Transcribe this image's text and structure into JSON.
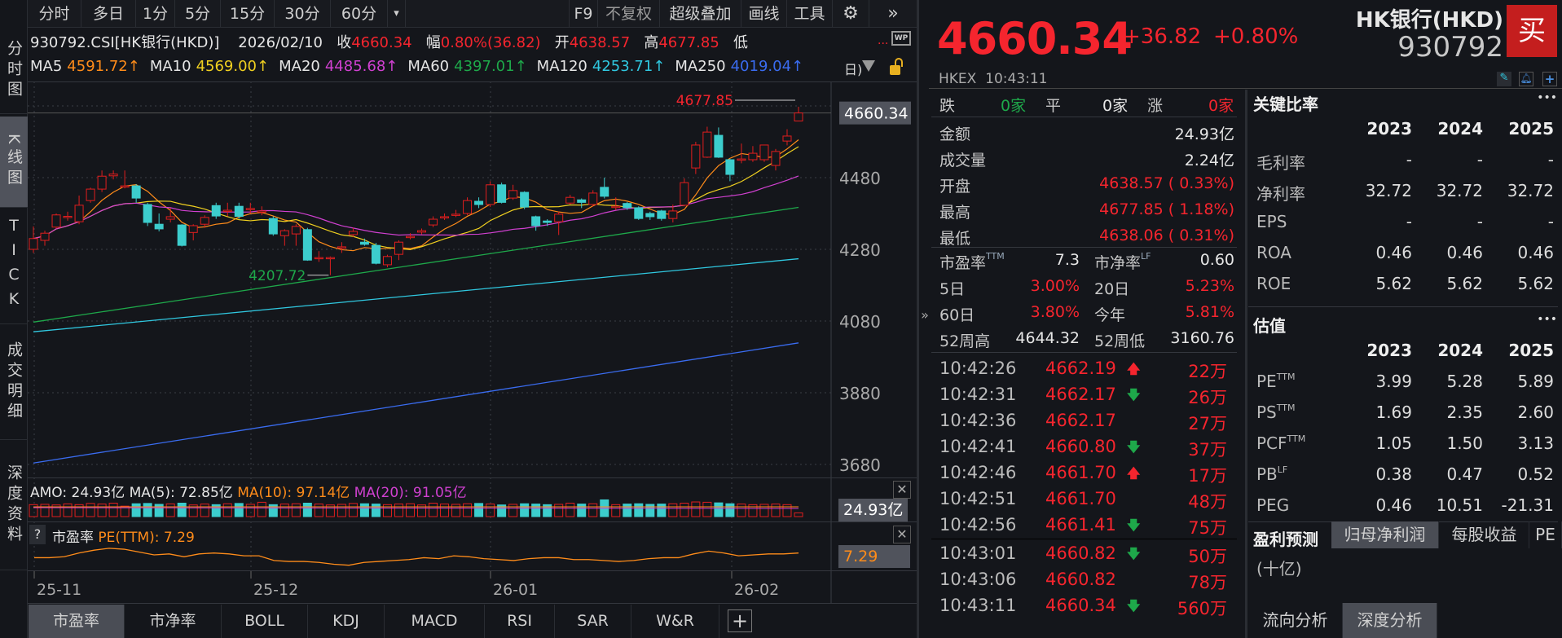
{
  "sidebar": {
    "items": [
      {
        "label": "分时图"
      },
      {
        "label": "K线图"
      },
      {
        "label": "TICK"
      },
      {
        "label": "成交明细"
      },
      {
        "label": "深度资料"
      }
    ]
  },
  "toolbar": {
    "periods": [
      "分时",
      "多日",
      "1分",
      "5分",
      "15分",
      "30分",
      "60分"
    ],
    "more": "▾",
    "f9": "F9",
    "adjust": "不复权",
    "overlay": "超级叠加",
    "draw": "画线",
    "tools": "工具",
    "gear": "⚙",
    "expand": "»"
  },
  "info": {
    "code": "930792.CSI[HK银行(HKD)]",
    "date": "2026/02/10",
    "close_label": "收",
    "close": "4660.34",
    "amp_label": "幅",
    "amp": "0.80%(36.82)",
    "open_label": "开",
    "open": "4638.57",
    "high_label": "高",
    "high": "4677.85",
    "low_label": "低",
    "more": "...",
    "wp": "WP"
  },
  "ma": [
    {
      "name": "MA5",
      "value": "4591.72↑",
      "color": "#ff8c1a"
    },
    {
      "name": "MA10",
      "value": "4569.00↑",
      "color": "#f0d020"
    },
    {
      "name": "MA20",
      "value": "4485.68↑",
      "color": "#d040d0"
    },
    {
      "name": "MA60",
      "value": "4397.01↑",
      "color": "#1ea84a"
    },
    {
      "name": "MA120",
      "value": "4253.71↑",
      "color": "#30c8e0"
    },
    {
      "name": "MA250",
      "value": "4019.04↑",
      "color": "#3a6cf0"
    }
  ],
  "ma_extra": "日)",
  "chart_data": {
    "type": "candlestick",
    "yticks": [
      4680,
      4480,
      4280,
      4080,
      3880,
      3680
    ],
    "ytick_labels": [
      "4680",
      "4480",
      "4280",
      "4080",
      "3880",
      "3680"
    ],
    "ylim": [
      3660,
      4700
    ],
    "xlabels": [
      {
        "label": "25-11",
        "index": 0
      },
      {
        "label": "25-12",
        "index": 19
      },
      {
        "label": "26-01",
        "index": 40
      },
      {
        "label": "26-02",
        "index": 61
      }
    ],
    "ohlc": [
      [
        4280,
        4344,
        4270,
        4310
      ],
      [
        4305,
        4332,
        4290,
        4325
      ],
      [
        4342,
        4380,
        4338,
        4376
      ],
      [
        4372,
        4385,
        4360,
        4372
      ],
      [
        4357,
        4430,
        4350,
        4403
      ],
      [
        4416,
        4452,
        4410,
        4448
      ],
      [
        4448,
        4500,
        4440,
        4484
      ],
      [
        4485,
        4500,
        4475,
        4490
      ],
      [
        4457,
        4500,
        4450,
        4457
      ],
      [
        4457,
        4462,
        4410,
        4423
      ],
      [
        4405,
        4410,
        4345,
        4355
      ],
      [
        4350,
        4380,
        4330,
        4337
      ],
      [
        4364,
        4395,
        4355,
        4371
      ],
      [
        4348,
        4350,
        4288,
        4291
      ],
      [
        4327,
        4350,
        4305,
        4346
      ],
      [
        4350,
        4375,
        4340,
        4369
      ],
      [
        4402,
        4410,
        4365,
        4373
      ],
      [
        4389,
        4410,
        4372,
        4389
      ],
      [
        4400,
        4410,
        4365,
        4372
      ],
      [
        4394,
        4410,
        4380,
        4394
      ],
      [
        4387,
        4400,
        4375,
        4387
      ],
      [
        4366,
        4372,
        4318,
        4323
      ],
      [
        4318,
        4336,
        4290,
        4332
      ],
      [
        4323,
        4350,
        4290,
        4344
      ],
      [
        4335,
        4340,
        4248,
        4250
      ],
      [
        4257,
        4275,
        4245,
        4257
      ],
      [
        4257,
        4260,
        4208,
        4257
      ],
      [
        4287,
        4300,
        4270,
        4287
      ],
      [
        4321,
        4340,
        4315,
        4330
      ],
      [
        4300,
        4310,
        4290,
        4294
      ],
      [
        4291,
        4298,
        4238,
        4241
      ],
      [
        4237,
        4265,
        4230,
        4260
      ],
      [
        4266,
        4305,
        4250,
        4300
      ],
      [
        4316,
        4325,
        4308,
        4316
      ],
      [
        4328,
        4338,
        4322,
        4332
      ],
      [
        4348,
        4372,
        4342,
        4364
      ],
      [
        4371,
        4380,
        4362,
        4371
      ],
      [
        4378,
        4390,
        4370,
        4378
      ],
      [
        4380,
        4425,
        4375,
        4416
      ],
      [
        4414,
        4425,
        4395,
        4405
      ],
      [
        4405,
        4470,
        4398,
        4460
      ],
      [
        4460,
        4466,
        4408,
        4411
      ],
      [
        4423,
        4460,
        4418,
        4444
      ],
      [
        4439,
        4442,
        4392,
        4398
      ],
      [
        4371,
        4374,
        4332,
        4346
      ],
      [
        4359,
        4364,
        4345,
        4355
      ],
      [
        4357,
        4385,
        4320,
        4378
      ],
      [
        4409,
        4432,
        4405,
        4425
      ],
      [
        4418,
        4422,
        4395,
        4411
      ],
      [
        4405,
        4445,
        4400,
        4437
      ],
      [
        4453,
        4480,
        4422,
        4428
      ],
      [
        4400,
        4425,
        4390,
        4400
      ],
      [
        4408,
        4412,
        4390,
        4396
      ],
      [
        4396,
        4400,
        4362,
        4366
      ],
      [
        4380,
        4385,
        4362,
        4371
      ],
      [
        4387,
        4390,
        4360,
        4366
      ],
      [
        4366,
        4405,
        4355,
        4387
      ],
      [
        4403,
        4478,
        4400,
        4466
      ],
      [
        4507,
        4580,
        4490,
        4571
      ],
      [
        4537,
        4622,
        4535,
        4607
      ],
      [
        4598,
        4620,
        4535,
        4537
      ],
      [
        4530,
        4532,
        4470,
        4489
      ],
      [
        4532,
        4575,
        4520,
        4532
      ],
      [
        4530,
        4568,
        4524,
        4548
      ],
      [
        4530,
        4571,
        4524,
        4571
      ],
      [
        4514,
        4560,
        4500,
        4553
      ],
      [
        4582,
        4615,
        4570,
        4596
      ],
      [
        4638,
        4677.85,
        4638,
        4660.34
      ]
    ],
    "ma_long": [
      {
        "name": "MA60",
        "start": 4077,
        "end": 4397.01,
        "color": "#1ea84a"
      },
      {
        "name": "MA120",
        "start": 4050,
        "end": 4253.71,
        "color": "#30c8e0"
      },
      {
        "name": "MA250",
        "start": 3684,
        "end": 4019.04,
        "color": "#3a6cf0"
      }
    ],
    "high_label": "4677.85",
    "low_label": "4207.72",
    "last_price": "4660.34",
    "amo": {
      "title": "AMO: 24.93亿",
      "ma5": "MA(5): 72.85亿",
      "ma10": "MA(10): 97.14亿",
      "ma20": "MA(20): 91.05亿",
      "last": "24.93亿",
      "values": [
        80,
        82,
        78,
        85,
        80,
        88,
        84,
        90,
        70,
        86,
        88,
        82,
        85,
        90,
        78,
        84,
        80,
        86,
        88,
        82,
        96,
        80,
        84,
        86,
        90,
        84,
        78,
        82,
        88,
        86,
        84,
        80,
        84,
        86,
        78,
        90,
        84,
        82,
        86,
        88,
        84,
        78,
        82,
        86,
        84,
        80,
        82,
        90,
        84,
        86,
        112,
        80,
        84,
        86,
        82,
        84,
        86,
        90,
        98,
        96,
        92,
        86,
        84,
        80,
        82,
        84,
        80,
        25
      ]
    },
    "pe": {
      "help": "?",
      "title": "市盈率",
      "name": "PE(TTM): 7.29",
      "last": "7.29",
      "values": [
        7.2,
        7.2,
        7.22,
        7.3,
        7.36,
        7.4,
        7.38,
        7.32,
        7.26,
        7.28,
        7.22,
        7.28,
        7.3,
        7.28,
        7.24,
        7.24,
        7.14,
        7.12,
        7.12,
        7.1,
        7.06,
        7.04,
        7.1,
        7.12,
        7.14,
        7.16,
        7.2,
        7.18,
        7.24,
        7.22,
        7.18,
        7.16,
        7.14,
        7.18,
        7.2,
        7.2,
        7.16,
        7.16,
        7.14,
        7.12,
        7.14,
        7.18,
        7.2,
        7.2,
        7.28,
        7.34,
        7.3,
        7.24,
        7.26,
        7.28,
        7.28,
        7.3
      ]
    }
  },
  "bottom_tabs": [
    "市盈率",
    "市净率",
    "BOLL",
    "KDJ",
    "MACD",
    "RSI",
    "SAR",
    "W&R",
    "+"
  ],
  "quote": {
    "price": "4660.34",
    "change": "+36.82",
    "pct": "+0.80%",
    "name": "HK银行(HKD)",
    "code": "930792",
    "buy": "买",
    "exchange": "HKEX",
    "time": "10:43:11"
  },
  "breadth": {
    "down_label": "跌",
    "down": "0家",
    "flat_label": "平",
    "flat": "0家",
    "up_label": "涨",
    "up": "0家"
  },
  "stats": [
    {
      "label": "金额",
      "value": "24.93亿",
      "color": "wht"
    },
    {
      "label": "成交量",
      "value": "2.24亿",
      "color": "wht"
    },
    {
      "label": "开盘",
      "value": "4638.57 ( 0.33%)",
      "color": "red"
    },
    {
      "label": "最高",
      "value": "4677.85 ( 1.18%)",
      "color": "red"
    },
    {
      "label": "最低",
      "value": "4638.06 ( 0.31%)",
      "color": "red"
    }
  ],
  "stats2": [
    {
      "l1": "市盈率",
      "s1": "TTM",
      "v1": "7.3",
      "c1": "wht",
      "l2": "市净率",
      "s2": "LF",
      "v2": "0.60",
      "c2": "wht"
    },
    {
      "l1": "5日",
      "s1": "",
      "v1": "3.00%",
      "c1": "red",
      "l2": "20日",
      "s2": "",
      "v2": "5.23%",
      "c2": "red"
    },
    {
      "l1": "60日",
      "s1": "",
      "v1": "3.80%",
      "c1": "red",
      "l2": "今年",
      "s2": "",
      "v2": "5.81%",
      "c2": "red"
    },
    {
      "l1": "52周高",
      "s1": "",
      "v1": "4644.32",
      "c1": "wht",
      "l2": "52周低",
      "s2": "",
      "v2": "3160.76",
      "c2": "wht"
    }
  ],
  "ticks": [
    {
      "time": "10:42:26",
      "price": "4662.19",
      "dir": "up",
      "vol": "22万"
    },
    {
      "time": "10:42:31",
      "price": "4662.17",
      "dir": "down",
      "vol": "26万"
    },
    {
      "time": "10:42:36",
      "price": "4662.17",
      "dir": "",
      "vol": "27万"
    },
    {
      "time": "10:42:41",
      "price": "4660.80",
      "dir": "down",
      "vol": "37万"
    },
    {
      "time": "10:42:46",
      "price": "4661.70",
      "dir": "up",
      "vol": "17万"
    },
    {
      "time": "10:42:51",
      "price": "4661.70",
      "dir": "",
      "vol": "48万"
    },
    {
      "time": "10:42:56",
      "price": "4661.41",
      "dir": "down",
      "vol": "75万"
    },
    {
      "time": "10:43:01",
      "price": "4660.82",
      "dir": "down",
      "vol": "50万"
    },
    {
      "time": "10:43:06",
      "price": "4660.82",
      "dir": "",
      "vol": "78万"
    },
    {
      "time": "10:43:11",
      "price": "4660.34",
      "dir": "down",
      "vol": "560万"
    }
  ],
  "ratios": {
    "title": "关键比率",
    "more": "•••",
    "years": [
      "2023",
      "2024",
      "2025"
    ],
    "rows": [
      {
        "label": "毛利率",
        "sup": "",
        "values": [
          "-",
          "-",
          "-"
        ]
      },
      {
        "label": "净利率",
        "sup": "",
        "values": [
          "32.72",
          "32.72",
          "32.72"
        ]
      },
      {
        "label": "EPS",
        "sup": "",
        "values": [
          "-",
          "-",
          "-"
        ]
      },
      {
        "label": "ROA",
        "sup": "",
        "values": [
          "0.46",
          "0.46",
          "0.46"
        ]
      },
      {
        "label": "ROE",
        "sup": "",
        "values": [
          "5.62",
          "5.62",
          "5.62"
        ]
      }
    ]
  },
  "valuation": {
    "title": "估值",
    "more": "•••",
    "years": [
      "2023",
      "2024",
      "2025"
    ],
    "rows": [
      {
        "label": "PE",
        "sup": "TTM",
        "values": [
          "3.99",
          "5.28",
          "5.89"
        ]
      },
      {
        "label": "PS",
        "sup": "TTM",
        "values": [
          "1.69",
          "2.35",
          "2.60"
        ]
      },
      {
        "label": "PCF",
        "sup": "TTM",
        "values": [
          "1.05",
          "1.50",
          "3.13"
        ]
      },
      {
        "label": "PB",
        "sup": "LF",
        "values": [
          "0.38",
          "0.47",
          "0.52"
        ]
      },
      {
        "label": "PEG",
        "sup": "",
        "values": [
          "0.46",
          "10.51",
          "-21.31"
        ]
      }
    ]
  },
  "forecast": {
    "title": "盈利预测",
    "tabs": [
      "归母净利润",
      "每股收益",
      "PE"
    ],
    "unit": "(十亿)"
  },
  "analysis_tabs": [
    "流向分析",
    "深度分析"
  ]
}
